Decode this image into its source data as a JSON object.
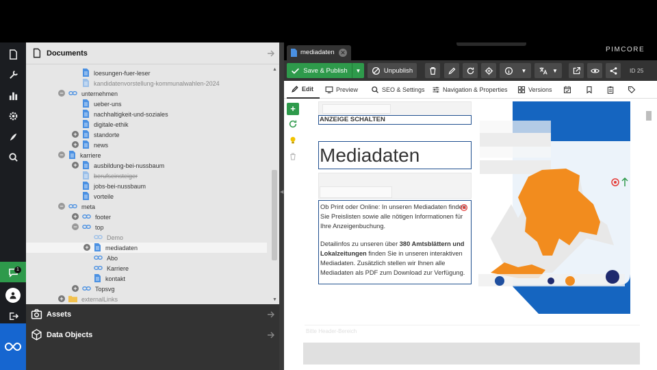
{
  "sidebar_nav": {
    "items": [
      "documents-icon",
      "wrench-icon",
      "chart-icon",
      "gear-icon",
      "feather-icon",
      "search-icon"
    ],
    "chat_badge": "1"
  },
  "documents": {
    "title": "Documents",
    "tree": [
      {
        "label": "loesungen-fuer-leser",
        "type": "page",
        "state": "normal",
        "depth": 3,
        "expander": ""
      },
      {
        "label": "kandidatenvorstellung-kommunalwahlen-2024",
        "type": "page",
        "state": "dim",
        "depth": 3,
        "expander": ""
      },
      {
        "label": "unternehmen",
        "type": "link",
        "state": "normal",
        "depth": 2,
        "expander": "minus"
      },
      {
        "label": "ueber-uns",
        "type": "page",
        "state": "normal",
        "depth": 3,
        "expander": ""
      },
      {
        "label": "nachhaltigkeit-und-soziales",
        "type": "page",
        "state": "normal",
        "depth": 3,
        "expander": ""
      },
      {
        "label": "digitale-ethik",
        "type": "page",
        "state": "normal",
        "depth": 3,
        "expander": ""
      },
      {
        "label": "standorte",
        "type": "page",
        "state": "normal",
        "depth": 3,
        "expander": "plus"
      },
      {
        "label": "news",
        "type": "page",
        "state": "normal",
        "depth": 3,
        "expander": "plus"
      },
      {
        "label": "karriere",
        "type": "page",
        "state": "normal",
        "depth": 2,
        "expander": "minus"
      },
      {
        "label": "ausbildung-bei-nussbaum",
        "type": "page",
        "state": "normal",
        "depth": 3,
        "expander": "plus"
      },
      {
        "label": "berufseinsteiger",
        "type": "page",
        "state": "strike",
        "depth": 3,
        "expander": ""
      },
      {
        "label": "jobs-bei-nussbaum",
        "type": "page",
        "state": "normal",
        "depth": 3,
        "expander": ""
      },
      {
        "label": "vorteile",
        "type": "page",
        "state": "normal",
        "depth": 3,
        "expander": ""
      },
      {
        "label": "meta",
        "type": "link",
        "state": "normal",
        "depth": 2,
        "expander": "minus"
      },
      {
        "label": "footer",
        "type": "link",
        "state": "normal",
        "depth": 3,
        "expander": "plus"
      },
      {
        "label": "top",
        "type": "link",
        "state": "normal",
        "depth": 3,
        "expander": "minus"
      },
      {
        "label": "Demo",
        "type": "link",
        "state": "dim",
        "depth": 4,
        "expander": ""
      },
      {
        "label": "mediadaten",
        "type": "page",
        "state": "selected",
        "depth": 4,
        "expander": "plus"
      },
      {
        "label": "Abo",
        "type": "link",
        "state": "normal",
        "depth": 4,
        "expander": ""
      },
      {
        "label": "Karriere",
        "type": "link",
        "state": "normal",
        "depth": 4,
        "expander": ""
      },
      {
        "label": "kontakt",
        "type": "page",
        "state": "normal",
        "depth": 4,
        "expander": ""
      },
      {
        "label": "Topsvg",
        "type": "link",
        "state": "normal",
        "depth": 3,
        "expander": "plus"
      },
      {
        "label": "externalLinks",
        "type": "folder",
        "state": "dim",
        "depth": 2,
        "expander": "plus"
      }
    ]
  },
  "panels": {
    "assets": "Assets",
    "data_objects": "Data Objects"
  },
  "tab": {
    "label": "mediadaten"
  },
  "brand": "PIMCORE",
  "toolbar": {
    "save_publish": "Save & Publish",
    "unpublish": "Unpublish",
    "id": "ID 25"
  },
  "subtabs": [
    "Edit",
    "Preview",
    "SEO & Settings",
    "Navigation & Properties",
    "Versions"
  ],
  "content": {
    "kicker": "ANZEIGE SCHALTEN",
    "headline": "Mediadaten",
    "para1": "Ob Print oder Online: In unseren Mediadaten finden Sie Preislisten sowie alle nötigen Informationen für Ihre Anzeigenbuchung.",
    "para2_a": "Detailinfos zu unseren über ",
    "para2_b": "380 Amtsblättern und Lokalzeitungen",
    "para2_c": " finden Sie in unseren interaktiven Mediadaten. Zusätzlich stellen wir Ihnen alle Mediadaten als PDF zum Download zur Verfügung.",
    "footer_area": "Bitte Header-Bereich"
  },
  "colors": {
    "accent_green": "#2ea043",
    "orange": "#f28c1e",
    "blue": "#1565c0",
    "dark_blue": "#1f2a6e"
  }
}
